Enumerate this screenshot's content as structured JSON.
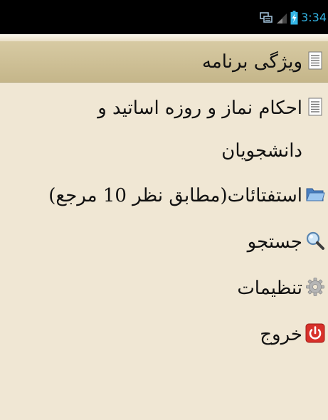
{
  "status_bar": {
    "time": "3:34",
    "icons": [
      "sync-icon",
      "signal-icon",
      "battery-charging-icon"
    ],
    "background": "#000000",
    "clock_color": "#33b5e5"
  },
  "menu": {
    "header": {
      "label": "ویژگی برنامه",
      "icon": "document-icon"
    },
    "items": [
      {
        "label": "احکام نماز و روزه اساتید و دانشجویان",
        "icon": "document-icon"
      },
      {
        "label": "استفتائات(مطابق نظر 10 مرجع)",
        "icon": "folder-icon"
      },
      {
        "label": "جستجو",
        "icon": "search-icon"
      },
      {
        "label": "تنظیمات",
        "icon": "gear-icon"
      },
      {
        "label": "خروج",
        "icon": "power-icon"
      }
    ]
  },
  "colors": {
    "background": "#f0e7d4",
    "header_background": "#cdbf94",
    "text": "#111111",
    "exit_icon": "#d8312a"
  }
}
